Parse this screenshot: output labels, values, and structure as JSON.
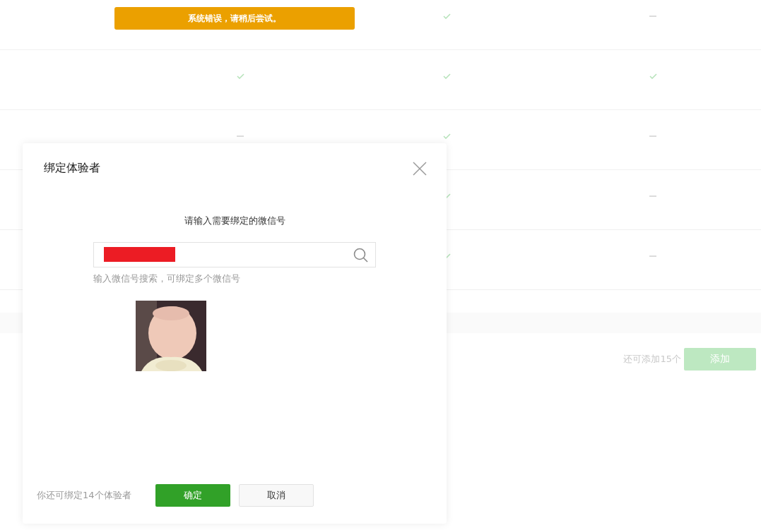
{
  "toast": {
    "text": "系统错误，请稍后尝试。"
  },
  "table": {
    "rows": [
      {
        "cells": [
          {
            "kind": "empty"
          },
          {
            "kind": "check"
          },
          {
            "kind": "dash"
          }
        ]
      },
      {
        "cells": [
          {
            "kind": "check"
          },
          {
            "kind": "check"
          },
          {
            "kind": "check"
          }
        ]
      },
      {
        "cells": [
          {
            "kind": "dash"
          },
          {
            "kind": "check"
          },
          {
            "kind": "dash"
          }
        ]
      },
      {
        "cells": [
          {
            "kind": "empty"
          },
          {
            "kind": "check"
          },
          {
            "kind": "dash"
          }
        ]
      },
      {
        "cells": [
          {
            "kind": "empty"
          },
          {
            "kind": "check"
          },
          {
            "kind": "dash"
          }
        ]
      }
    ]
  },
  "footer": {
    "remaining": "还可添加15个",
    "add_button": {
      "label": "添加",
      "disabled": true
    }
  },
  "dialog": {
    "title": "绑定体验者",
    "prompt": "请输入需要绑定的微信号",
    "search": {
      "redacted": true
    },
    "hint": "输入微信号搜索，可绑定多个微信号",
    "remaining": "你还可绑定14个体验者",
    "buttons": [
      {
        "label": "确定",
        "kind": "primary"
      },
      {
        "label": "取消",
        "kind": "default"
      }
    ]
  }
}
